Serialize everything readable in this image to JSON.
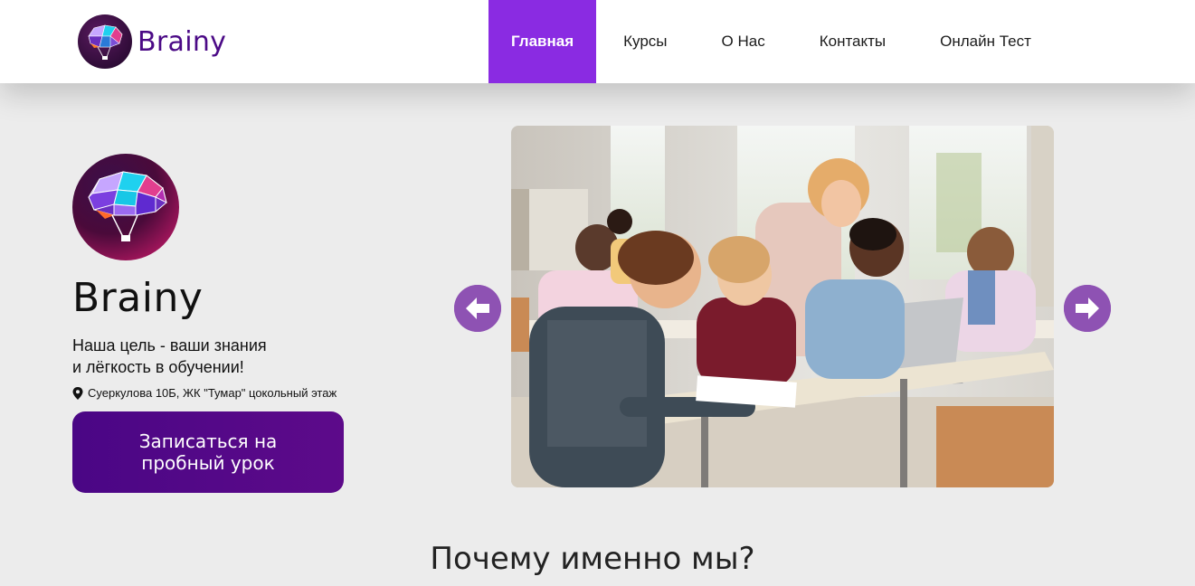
{
  "header": {
    "logo_text": "Brainy",
    "nav": [
      {
        "label": "Главная",
        "active": true
      },
      {
        "label": "Курсы",
        "active": false
      },
      {
        "label": "О Нас",
        "active": false
      },
      {
        "label": "Контакты",
        "active": false
      },
      {
        "label": "Онлайн Тест",
        "active": false
      }
    ]
  },
  "hero": {
    "title": "Brainy",
    "tagline_line1": "Наша цель - ваши знания",
    "tagline_line2": "и лёгкость в обучении!",
    "address": "Суеркулова 10Б, ЖК \"Тумар\" цокольный этаж",
    "address_icon": "map-pin-icon",
    "cta_label": "Записаться на пробный урок"
  },
  "slider": {
    "prev_icon": "arrow-left-icon",
    "next_icon": "arrow-right-icon"
  },
  "section": {
    "title": "Почему именно мы?"
  },
  "colors": {
    "accent_purple": "#8a2be2",
    "cta_purple": "#4a0685",
    "arrow_purple": "#8e52b3",
    "logo_text": "#4b0a86",
    "page_bg": "#ececec"
  }
}
